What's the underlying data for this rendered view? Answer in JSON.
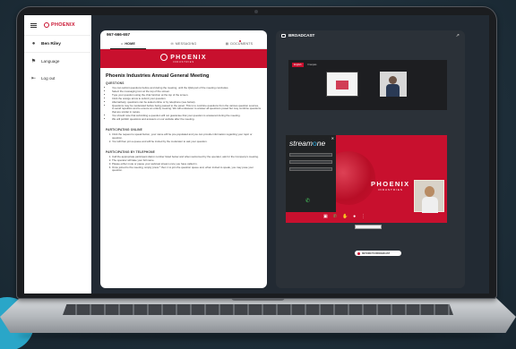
{
  "colors": {
    "accent": "#c8102e",
    "background": "#1f303b",
    "teal": "#2aa6c8"
  },
  "sidebar": {
    "brand": "PHOENIX",
    "user": "Ben Riley",
    "items": [
      {
        "label": "Language",
        "icon": "flag-icon"
      },
      {
        "label": "Log out",
        "icon": "logout-icon"
      }
    ]
  },
  "main": {
    "meeting_id": "967-666-657",
    "tabs": [
      {
        "label": "HOME",
        "icon": "home-icon",
        "active": true
      },
      {
        "label": "MESSAGING",
        "icon": "message-icon"
      },
      {
        "label": "DOCUMENTS",
        "icon": "document-icon"
      }
    ],
    "banner": {
      "name": "PHOENIX",
      "sub": "INDUSTRIES"
    },
    "title": "Phoenix Industries Annual General Meeting",
    "questions_heading": "QUESTIONS",
    "questions": [
      "You can submit questions before and during the meeting, until the Q&A part of the meeting concludes.",
      "Select the messaging icon at the top of the screen.",
      "Type your question using the chat function at the top of the screen.",
      "Click the orange arrow to submit your question.",
      "Alternatively, questions can be asked online or by telephone (see below).",
      "Questions may be moderated before being passed to the panel. This is to combine questions from the various question sources, to avoid repetition and to ensure an orderly meeting. We will endeavour to answer all questions posed but may combine questions that are similar in nature.",
      "You should note that submitting a question will not guarantee that your question is answered during the meeting.",
      "We will publish questions and answers on our website after the meeting."
    ],
    "online_heading": "PARTICIPATING ONLINE",
    "online": [
      "Click the request to speak button, your name will be pre-populated and you can provide information regarding your topic or question.",
      "You will then join a queue and will be invited by the moderator to ask your question."
    ],
    "phone_heading": "PARTICIPATING BY TELEPHONE",
    "phone": [
      "Call the appropriate participant dial-in number listed below and when welcomed by the operator, ask for the Company's meeting.",
      "The operator will take your full name.",
      "Please either mute or pause your webcast stream once you have called in.",
      "Once joined to the meeting, simply press * then 1 to join the question queue and, when invited to speak, you may pose your question."
    ]
  },
  "broadcast": {
    "title": "BROADCAST",
    "lang_active": "English",
    "lang_other": "Français",
    "streamone": {
      "logo_a": "stream",
      "logo_o": "o",
      "logo_b": "ne"
    },
    "main_video": {
      "brand": "PHOENIX",
      "sub": "INDUSTRIES"
    },
    "return_button": "RETURN TO BROADCAST"
  }
}
